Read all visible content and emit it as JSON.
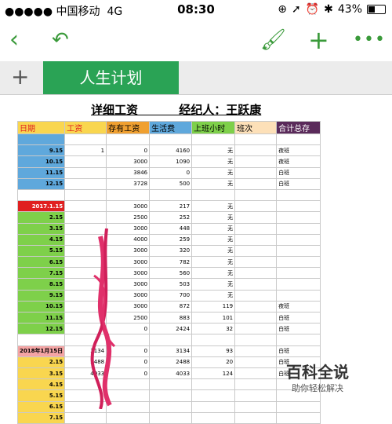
{
  "status": {
    "carrier": "●●●●● 中国移动",
    "network": "4G",
    "time": "08:30",
    "battery": "43%"
  },
  "tab": {
    "name": "人生计划",
    "add": "+"
  },
  "sheet_title": "详细工资          经纪人：王跃康",
  "columns": [
    "日期",
    "工资",
    "存有工资",
    "生活费",
    "上班小时",
    "班次",
    "合计总存"
  ],
  "colors": {
    "accent": "#2aa355",
    "blue": "#5fa8dc",
    "green": "#7ed04a",
    "yellow": "#f9d64f",
    "red": "#e02020",
    "pink": "#f4a4a4"
  },
  "rows": [
    {
      "c": [
        "",
        "",
        "",
        "",
        "",
        "",
        ""
      ],
      "bg": "blue"
    },
    {
      "c": [
        "9.15",
        "1",
        "0",
        "4160",
        "无",
        "",
        "夜班"
      ],
      "bg": "blue"
    },
    {
      "c": [
        "10.15",
        "",
        "3000",
        "1090",
        "无",
        "",
        "夜班"
      ],
      "bg": "blue"
    },
    {
      "c": [
        "11.15",
        "",
        "3846",
        "0",
        "无",
        "",
        "白班"
      ],
      "bg": "blue"
    },
    {
      "c": [
        "12.15",
        "",
        "3728",
        "500",
        "无",
        "",
        "白班"
      ],
      "bg": "blue"
    },
    {
      "c": [
        "",
        "",
        "",
        "",
        "",
        "",
        ""
      ],
      "bg": ""
    },
    {
      "c": [
        "2017.1.15",
        "",
        "3000",
        "217",
        "无",
        "",
        ""
      ],
      "bg": "red"
    },
    {
      "c": [
        "2.15",
        "",
        "2500",
        "252",
        "无",
        "",
        ""
      ],
      "bg": "green"
    },
    {
      "c": [
        "3.15",
        "",
        "3000",
        "448",
        "无",
        "",
        ""
      ],
      "bg": "green"
    },
    {
      "c": [
        "4.15",
        "",
        "4000",
        "259",
        "无",
        "",
        ""
      ],
      "bg": "green"
    },
    {
      "c": [
        "5.15",
        "",
        "3000",
        "320",
        "无",
        "",
        ""
      ],
      "bg": "green"
    },
    {
      "c": [
        "6.15",
        "",
        "3000",
        "782",
        "无",
        "",
        ""
      ],
      "bg": "green"
    },
    {
      "c": [
        "7.15",
        "",
        "3000",
        "560",
        "无",
        "",
        ""
      ],
      "bg": "green"
    },
    {
      "c": [
        "8.15",
        "",
        "3000",
        "503",
        "无",
        "",
        ""
      ],
      "bg": "green"
    },
    {
      "c": [
        "9.15",
        "",
        "3000",
        "700",
        "无",
        "",
        ""
      ],
      "bg": "green"
    },
    {
      "c": [
        "10.15",
        "",
        "3000",
        "872",
        "119",
        "",
        "夜班"
      ],
      "bg": "green"
    },
    {
      "c": [
        "11.15",
        "",
        "2500",
        "883",
        "101",
        "",
        "白班"
      ],
      "bg": "green"
    },
    {
      "c": [
        "12.15",
        "",
        "0",
        "2424",
        "32",
        "",
        "白班"
      ],
      "bg": "green"
    },
    {
      "c": [
        "",
        "",
        "",
        "",
        "",
        "",
        ""
      ],
      "bg": ""
    },
    {
      "c": [
        "2018年1月15日",
        "3134",
        "0",
        "3134",
        "93",
        "",
        "白班"
      ],
      "bg": "pink"
    },
    {
      "c": [
        "2.15",
        "2488",
        "0",
        "2488",
        "20",
        "",
        "白班"
      ],
      "bg": "yellow"
    },
    {
      "c": [
        "3.15",
        "4033",
        "0",
        "4033",
        "124",
        "",
        "白班"
      ],
      "bg": "yellow"
    },
    {
      "c": [
        "4.15",
        "",
        "",
        "",
        "",
        "",
        ""
      ],
      "bg": "yellow"
    },
    {
      "c": [
        "5.15",
        "",
        "",
        "",
        "",
        "",
        ""
      ],
      "bg": "yellow"
    },
    {
      "c": [
        "6.15",
        "",
        "",
        "",
        "",
        "",
        ""
      ],
      "bg": "yellow"
    },
    {
      "c": [
        "7.15",
        "",
        "",
        "",
        "",
        "",
        ""
      ],
      "bg": "yellow"
    }
  ],
  "watermark": {
    "main": "百科全说",
    "sub": "助你轻松解决"
  }
}
